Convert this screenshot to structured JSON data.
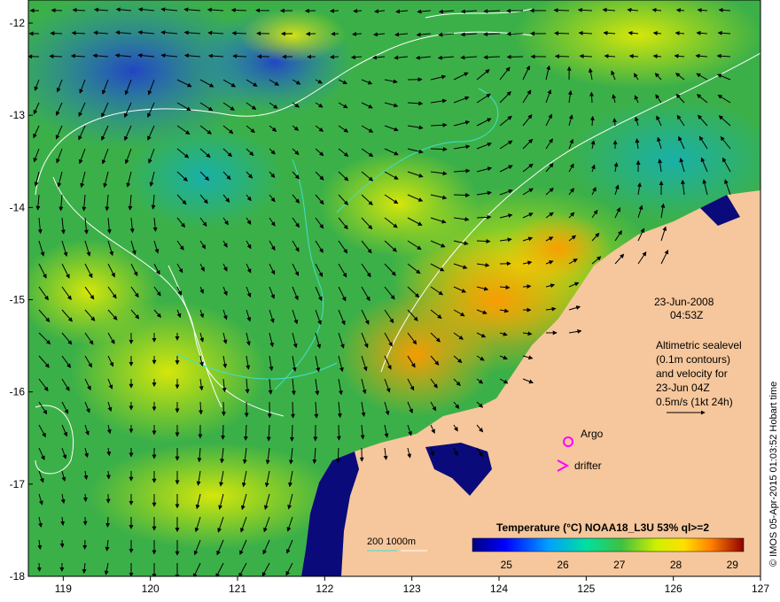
{
  "map": {
    "lon_ticks": [
      "119",
      "120",
      "121",
      "122",
      "123",
      "124",
      "125",
      "126",
      "127"
    ],
    "lat_ticks": [
      "-12",
      "-13",
      "-14",
      "-15",
      "-16",
      "-17",
      "-18"
    ],
    "lon_range": [
      118.6,
      127.0
    ],
    "lat_range": [
      -18.0,
      -11.75
    ],
    "colors": {
      "land": "#f6c79c",
      "shallow": "#0a0a7a",
      "contour": "#ffffff",
      "isobath": "#40e0d0",
      "marker": "#ff00ff"
    }
  },
  "annotations": {
    "date": "23-Jun-2008",
    "time": "04:53Z",
    "note_line1": "Altimetric sealevel",
    "note_line2": "(0.1m contours)",
    "note_line3": "and velocity for",
    "note_line4": "23-Jun 04Z",
    "note_line5": "0.5m/s (1kt 24h)"
  },
  "legend": {
    "argo_label": "Argo",
    "drifter_label": "drifter",
    "depth_label": "200  1000m"
  },
  "colorbar": {
    "title": "Temperature (°C) NOAA18_L3U 53% ql>=2",
    "ticks": [
      "25",
      "26",
      "27",
      "28",
      "29"
    ],
    "range": [
      24.4,
      29.2
    ]
  },
  "credit": "© IMOS 05-Apr-2015 01:03:52 Hobart time"
}
